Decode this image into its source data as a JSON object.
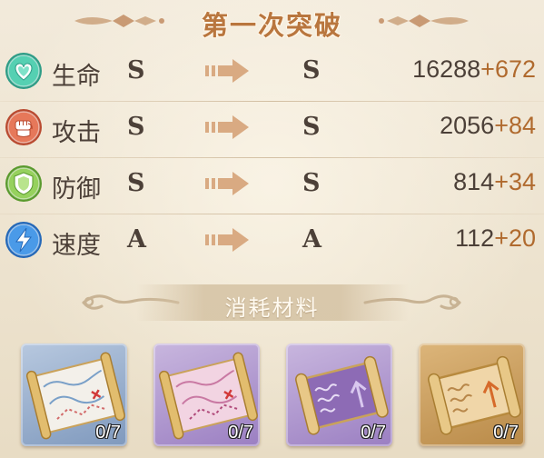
{
  "title": "第一次突破",
  "stats": [
    {
      "name": "生命",
      "icon": "heart-icon",
      "from_grade": "S",
      "to_grade": "S",
      "base": "16288",
      "bonus": "+672",
      "color": "#3fbf9f"
    },
    {
      "name": "攻击",
      "icon": "fist-icon",
      "from_grade": "S",
      "to_grade": "S",
      "base": "2056",
      "bonus": "+84",
      "color": "#e06a4a"
    },
    {
      "name": "防御",
      "icon": "shield-icon",
      "from_grade": "S",
      "to_grade": "S",
      "base": "814",
      "bonus": "+34",
      "color": "#7fc24a"
    },
    {
      "name": "速度",
      "icon": "lightning-icon",
      "from_grade": "A",
      "to_grade": "A",
      "base": "112",
      "bonus": "+20",
      "color": "#3a8fe0"
    }
  ],
  "materials": {
    "title": "消耗材料",
    "items": [
      {
        "icon": "map-scroll-icon",
        "count": "0/7",
        "rarity_color": "#8ea6c9"
      },
      {
        "icon": "map-scroll-icon",
        "count": "0/7",
        "rarity_color": "#a98fc6"
      },
      {
        "icon": "upgrade-scroll-icon",
        "count": "0/7",
        "rarity_color": "#a98fc6"
      },
      {
        "icon": "upgrade-scroll-icon",
        "count": "0/7",
        "rarity_color": "#c49a5c"
      }
    ]
  },
  "colors": {
    "title": "#b9763e",
    "bonus": "#b06a2e",
    "text": "#4c4038",
    "arrow": "#d9aa82"
  }
}
